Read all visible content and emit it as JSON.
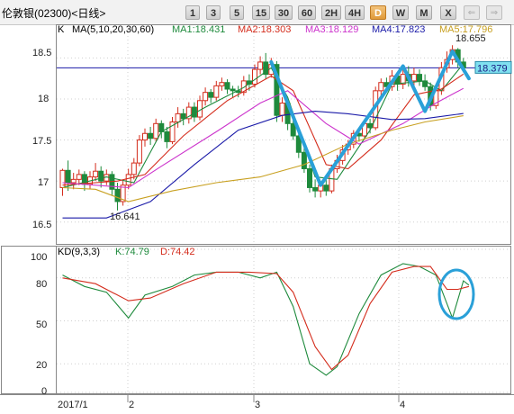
{
  "window": {
    "title": "伦敦银(02300)<日线>"
  },
  "periods": [
    {
      "label": "1",
      "active": false
    },
    {
      "label": "3",
      "active": false
    },
    {
      "label": "5",
      "active": false
    },
    {
      "label": "15",
      "active": false
    },
    {
      "label": "30",
      "active": false
    },
    {
      "label": "60",
      "active": false
    },
    {
      "label": "2H",
      "active": false
    },
    {
      "label": "4H",
      "active": false
    },
    {
      "label": "D",
      "active": true
    },
    {
      "label": "W",
      "active": false
    },
    {
      "label": "M",
      "active": false
    },
    {
      "label": "X",
      "active": false
    }
  ],
  "nav": [
    "⇐",
    "⇒"
  ],
  "colors": {
    "ma1": "#1e8a3c",
    "ma2": "#d42c1c",
    "ma3": "#cc33cc",
    "ma4": "#1a1aa8",
    "ma5": "#c8a020",
    "k": "#1e8a3c",
    "d": "#d42c1c",
    "annot": "#2aa0d8",
    "up": "#d42c1c",
    "down": "#1e8a3c"
  },
  "price_panel": {
    "k_label": "K",
    "ma_params": "MA(5,10,20,30,60)",
    "ma_values": [
      "MA1:18.431",
      "MA2:18.303",
      "MA3:18.129",
      "MA4:17.823",
      "MA5:17.796"
    ],
    "current_price": "18.379",
    "high_label": "18.655",
    "low_label": "16.641",
    "y_ticks": [
      "18.5",
      "18",
      "17.5",
      "17",
      "16.5"
    ]
  },
  "kd_panel": {
    "label": "KD(9,3,3)",
    "k_value": "K:74.79",
    "d_value": "D:74.42",
    "y_ticks": [
      "100",
      "80",
      "50",
      "20",
      "0"
    ]
  },
  "x_axis": {
    "labels": [
      "2017/1",
      "2",
      "3",
      "4"
    ]
  },
  "chart_data": [
    {
      "type": "candlestick",
      "ylim": [
        16.3,
        18.8
      ],
      "current_price": 18.379,
      "candles": [
        [
          16.92,
          17.13,
          16.82,
          17.15
        ],
        [
          17.13,
          16.98,
          16.88,
          17.25
        ],
        [
          16.98,
          17.02,
          16.9,
          17.1
        ],
        [
          17.02,
          17.08,
          16.95,
          17.14
        ],
        [
          17.08,
          16.96,
          16.88,
          17.12
        ],
        [
          16.96,
          17.05,
          16.9,
          17.12
        ],
        [
          17.05,
          17.12,
          17.0,
          17.22
        ],
        [
          17.12,
          17.0,
          16.92,
          17.18
        ],
        [
          17.0,
          17.08,
          16.95,
          17.14
        ],
        [
          17.08,
          16.9,
          16.82,
          17.12
        ],
        [
          16.9,
          16.75,
          16.641,
          16.98
        ],
        [
          16.75,
          16.95,
          16.7,
          17.0
        ],
        [
          16.95,
          17.08,
          16.9,
          17.15
        ],
        [
          17.08,
          17.22,
          17.02,
          17.28
        ],
        [
          17.22,
          17.5,
          17.18,
          17.56
        ],
        [
          17.5,
          17.58,
          17.42,
          17.64
        ],
        [
          17.58,
          17.52,
          17.44,
          17.66
        ],
        [
          17.52,
          17.7,
          17.48,
          17.76
        ],
        [
          17.7,
          17.6,
          17.52,
          17.74
        ],
        [
          17.6,
          17.48,
          17.4,
          17.66
        ],
        [
          17.48,
          17.72,
          17.45,
          17.78
        ],
        [
          17.72,
          17.82,
          17.65,
          17.9
        ],
        [
          17.82,
          17.76,
          17.68,
          17.88
        ],
        [
          17.76,
          17.9,
          17.7,
          17.96
        ],
        [
          17.9,
          17.78,
          17.72,
          17.96
        ],
        [
          17.78,
          17.98,
          17.74,
          18.04
        ],
        [
          17.98,
          18.08,
          17.92,
          18.14
        ],
        [
          18.08,
          18.02,
          17.95,
          18.12
        ],
        [
          18.02,
          18.16,
          17.98,
          18.22
        ],
        [
          18.16,
          18.2,
          18.1,
          18.26
        ],
        [
          18.2,
          18.12,
          18.06,
          18.24
        ],
        [
          18.12,
          18.1,
          18.02,
          18.16
        ],
        [
          18.1,
          18.08,
          18.02,
          18.16
        ],
        [
          18.08,
          18.22,
          18.04,
          18.28
        ],
        [
          18.22,
          18.18,
          18.1,
          18.3
        ],
        [
          18.18,
          18.36,
          18.14,
          18.42
        ],
        [
          18.36,
          18.45,
          18.3,
          18.52
        ],
        [
          18.45,
          18.3,
          18.24,
          18.56
        ],
        [
          18.3,
          18.42,
          18.26,
          18.5
        ],
        [
          18.42,
          17.8,
          17.72,
          18.46
        ],
        [
          17.8,
          17.95,
          17.72,
          18.02
        ],
        [
          17.95,
          17.7,
          17.62,
          18.0
        ],
        [
          17.7,
          17.55,
          17.5,
          17.78
        ],
        [
          17.55,
          17.35,
          17.28,
          17.6
        ],
        [
          17.35,
          17.15,
          17.1,
          17.4
        ],
        [
          17.15,
          16.92,
          16.86,
          17.2
        ],
        [
          16.92,
          16.88,
          16.8,
          17.02
        ],
        [
          16.88,
          16.95,
          16.8,
          17.0
        ],
        [
          16.95,
          16.88,
          16.82,
          17.02
        ],
        [
          16.88,
          17.15,
          16.85,
          17.2
        ],
        [
          17.15,
          17.25,
          17.1,
          17.32
        ],
        [
          17.25,
          17.38,
          17.2,
          17.44
        ],
        [
          17.38,
          17.45,
          17.32,
          17.5
        ],
        [
          17.45,
          17.58,
          17.4,
          17.62
        ],
        [
          17.58,
          17.55,
          17.48,
          17.65
        ],
        [
          17.55,
          17.7,
          17.5,
          17.75
        ],
        [
          17.7,
          17.65,
          17.58,
          17.76
        ],
        [
          17.65,
          18.1,
          17.62,
          18.15
        ],
        [
          18.1,
          18.2,
          18.02,
          18.25
        ],
        [
          18.2,
          18.15,
          18.08,
          18.26
        ],
        [
          18.15,
          18.28,
          18.1,
          18.35
        ],
        [
          18.28,
          18.18,
          18.1,
          18.32
        ],
        [
          18.18,
          18.3,
          18.12,
          18.36
        ],
        [
          18.3,
          18.22,
          18.15,
          18.4
        ],
        [
          18.22,
          18.3,
          18.16,
          18.38
        ],
        [
          18.3,
          18.22,
          18.16,
          18.36
        ],
        [
          18.22,
          18.15,
          18.1,
          18.3
        ],
        [
          18.15,
          17.92,
          17.86,
          18.2
        ],
        [
          17.92,
          18.1,
          17.88,
          18.15
        ],
        [
          18.1,
          18.38,
          18.05,
          18.45
        ],
        [
          18.38,
          18.48,
          18.32,
          18.58
        ],
        [
          18.48,
          18.6,
          18.42,
          18.655
        ],
        [
          18.6,
          18.45,
          18.38,
          18.62
        ],
        [
          18.45,
          18.379,
          18.33,
          18.5
        ]
      ],
      "moving_averages": [
        {
          "name": "MA1",
          "values": [
            [
              0,
              16.92
            ],
            [
              8,
              17.05
            ],
            [
              13,
              16.98
            ],
            [
              18,
              17.6
            ],
            [
              26,
              17.9
            ],
            [
              33,
              18.14
            ],
            [
              38,
              18.38
            ],
            [
              41,
              18.02
            ],
            [
              46,
              17.05
            ],
            [
              50,
              17.02
            ],
            [
              56,
              17.62
            ],
            [
              60,
              18.18
            ],
            [
              66,
              18.22
            ],
            [
              69,
              18.1
            ],
            [
              73,
              18.431
            ]
          ]
        },
        {
          "name": "MA2",
          "values": [
            [
              0,
              16.95
            ],
            [
              10,
              17.0
            ],
            [
              15,
              17.08
            ],
            [
              22,
              17.55
            ],
            [
              30,
              17.98
            ],
            [
              38,
              18.28
            ],
            [
              42,
              18.1
            ],
            [
              48,
              17.2
            ],
            [
              52,
              17.15
            ],
            [
              58,
              17.5
            ],
            [
              64,
              18.05
            ],
            [
              69,
              18.12
            ],
            [
              73,
              18.303
            ]
          ]
        },
        {
          "name": "MA3",
          "values": [
            [
              0,
              16.98
            ],
            [
              12,
              16.92
            ],
            [
              18,
              17.18
            ],
            [
              28,
              17.6
            ],
            [
              36,
              17.95
            ],
            [
              41,
              18.1
            ],
            [
              48,
              17.7
            ],
            [
              54,
              17.45
            ],
            [
              62,
              17.7
            ],
            [
              68,
              17.95
            ],
            [
              73,
              18.129
            ]
          ]
        },
        {
          "name": "MA4",
          "values": [
            [
              0,
              16.55
            ],
            [
              8,
              16.55
            ],
            [
              16,
              16.75
            ],
            [
              24,
              17.2
            ],
            [
              32,
              17.62
            ],
            [
              40,
              17.8
            ],
            [
              46,
              17.85
            ],
            [
              52,
              17.82
            ],
            [
              60,
              17.75
            ],
            [
              66,
              17.76
            ],
            [
              73,
              17.823
            ]
          ]
        },
        {
          "name": "MA5",
          "values": [
            [
              0,
              16.92
            ],
            [
              6,
              16.9
            ],
            [
              12,
              16.75
            ],
            [
              20,
              16.88
            ],
            [
              28,
              16.98
            ],
            [
              36,
              17.05
            ],
            [
              44,
              17.2
            ],
            [
              52,
              17.45
            ],
            [
              60,
              17.62
            ],
            [
              66,
              17.72
            ],
            [
              73,
              17.796
            ]
          ]
        }
      ],
      "annotation_trend_lines": [
        [
          [
            38,
            18.45
          ],
          [
            47,
            16.95
          ],
          [
            62,
            18.4
          ],
          [
            66,
            17.85
          ],
          [
            71,
            18.58
          ],
          [
            74,
            18.25
          ]
        ]
      ]
    },
    {
      "type": "line",
      "title": "KD(9,3,3)",
      "ylim": [
        0,
        100
      ],
      "series": [
        {
          "name": "K",
          "points": [
            [
              0,
              82
            ],
            [
              4,
              74
            ],
            [
              8,
              70
            ],
            [
              12,
              52
            ],
            [
              15,
              68
            ],
            [
              20,
              74
            ],
            [
              24,
              82
            ],
            [
              28,
              84
            ],
            [
              32,
              84
            ],
            [
              36,
              80
            ],
            [
              39,
              84
            ],
            [
              42,
              60
            ],
            [
              45,
              20
            ],
            [
              48,
              12
            ],
            [
              50,
              18
            ],
            [
              54,
              55
            ],
            [
              58,
              82
            ],
            [
              62,
              90
            ],
            [
              65,
              88
            ],
            [
              68,
              82
            ],
            [
              71,
              52
            ],
            [
              73,
              78
            ],
            [
              74,
              75
            ]
          ]
        },
        {
          "name": "D",
          "points": [
            [
              0,
              80
            ],
            [
              6,
              76
            ],
            [
              12,
              64
            ],
            [
              16,
              66
            ],
            [
              22,
              76
            ],
            [
              28,
              84
            ],
            [
              34,
              84
            ],
            [
              39,
              83
            ],
            [
              42,
              70
            ],
            [
              46,
              32
            ],
            [
              49,
              16
            ],
            [
              52,
              26
            ],
            [
              56,
              62
            ],
            [
              60,
              84
            ],
            [
              64,
              88
            ],
            [
              67,
              88
            ],
            [
              70,
              72
            ],
            [
              72,
              72
            ],
            [
              74,
              74
            ]
          ]
        }
      ]
    }
  ]
}
